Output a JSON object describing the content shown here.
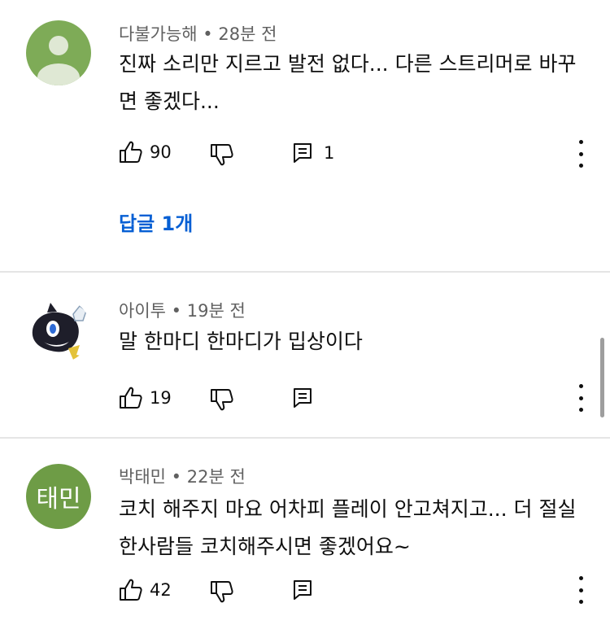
{
  "comments": [
    {
      "author": "다불가능해",
      "time": "28분 전",
      "text": "진짜 소리만 지르고 발전 없다... 다른 스트리머로 바꾸면 좋겠다...",
      "likes": "90",
      "replies": "1",
      "reply_link": "답글 1개",
      "avatar_icon": "default-person-avatar"
    },
    {
      "author": "아이투",
      "time": "19분 전",
      "text": "말 한마디 한마디가 밉상이다",
      "likes": "19",
      "avatar_icon": "cartoon-character-avatar"
    },
    {
      "author": "박태민",
      "time": "22분 전",
      "text": "코치 해주지 마요 어차피 플레이 안고쳐지고... 더 절실한사람들 코치해주시면 좋겠어요~",
      "likes": "42",
      "avatar_initials": "태민"
    }
  ],
  "colors": {
    "link": "#065fd4",
    "avatar_green": "#6e9c46",
    "meta_gray": "#606060"
  },
  "meta_separator": "•"
}
